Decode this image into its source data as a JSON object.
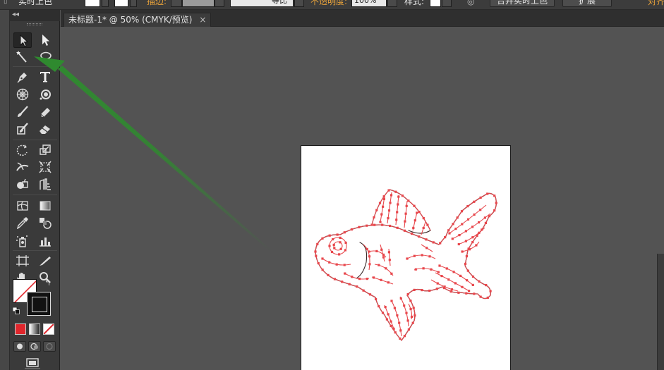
{
  "control_bar": {
    "selection_label": "实时上色",
    "stroke_label": "描边:",
    "stroke_profile": "等比",
    "opacity_label": "不透明度:",
    "opacity_value": "100%",
    "style_label": "样式:",
    "merge_button": "合并实时上色",
    "expand_button": "扩展",
    "align_button": "对齐"
  },
  "document_tab": {
    "title": "未标题-1* @ 50% (CMYK/预览)",
    "close_glyph": "×"
  },
  "tools_panel": {
    "collapse_glyph": "◂◂",
    "swap_glyph": "↰",
    "tools": [
      {
        "name": "selection-tool",
        "icon": "arrow-white"
      },
      {
        "name": "direct-selection-tool",
        "icon": "arrow-black"
      },
      {
        "name": "magic-wand-tool",
        "icon": "magic-wand"
      },
      {
        "name": "lasso-tool",
        "icon": "lasso"
      },
      {
        "name": "pen-tool",
        "icon": "pen"
      },
      {
        "name": "type-tool",
        "icon": "T"
      },
      {
        "name": "line-segment-tool",
        "icon": "grid-circle"
      },
      {
        "name": "rectangle-tool",
        "icon": "circle-shape"
      },
      {
        "name": "paintbrush-tool",
        "icon": "brush"
      },
      {
        "name": "pencil-tool",
        "icon": "pencil"
      },
      {
        "name": "blob-brush-tool",
        "icon": "blob-brush"
      },
      {
        "name": "eraser-tool",
        "icon": "eraser"
      },
      {
        "name": "rotate-tool",
        "icon": "rotate"
      },
      {
        "name": "scale-tool",
        "icon": "scale"
      },
      {
        "name": "width-tool",
        "icon": "width"
      },
      {
        "name": "free-transform-tool",
        "icon": "free-transform"
      },
      {
        "name": "shape-builder-tool",
        "icon": "shape-builder"
      },
      {
        "name": "perspective-grid-tool",
        "icon": "perspective-grid"
      },
      {
        "name": "mesh-tool",
        "icon": "mesh"
      },
      {
        "name": "gradient-tool",
        "icon": "gradient"
      },
      {
        "name": "eyedropper-tool",
        "icon": "eyedropper"
      },
      {
        "name": "blend-tool",
        "icon": "blend"
      },
      {
        "name": "symbol-sprayer-tool",
        "icon": "symbol-sprayer"
      },
      {
        "name": "column-graph-tool",
        "icon": "column-graph"
      },
      {
        "name": "artboard-tool",
        "icon": "artboard"
      },
      {
        "name": "slice-tool",
        "icon": "slice"
      },
      {
        "name": "hand-tool",
        "icon": "hand"
      },
      {
        "name": "zoom-tool",
        "icon": "magnifier"
      }
    ]
  },
  "colors": {
    "background": "#535353",
    "panel": "#3a3a3a",
    "artwork_stroke": "#e8474c",
    "annotation_arrow": "#2f8a2f",
    "artboard": "#ffffff"
  }
}
